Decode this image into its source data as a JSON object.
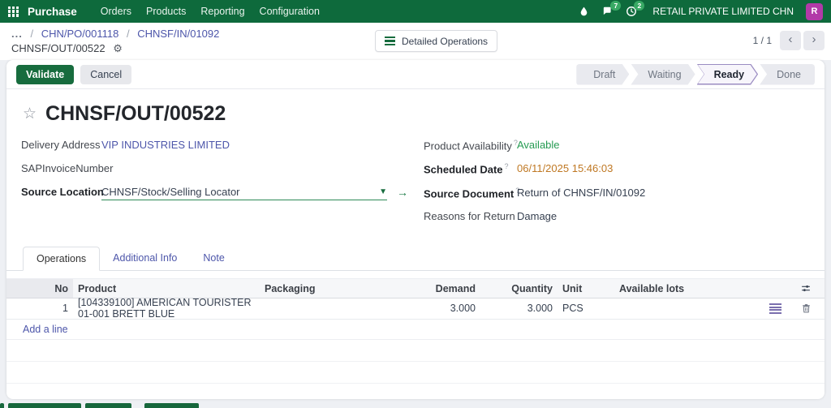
{
  "colors": {
    "nav_green": "#0e6a3c",
    "accent_green": "#176c3e",
    "link_purple": "#4d56aa",
    "available_green": "#259b52",
    "date_orange": "#bf7823",
    "ready_step_purple": "#9b8cc2",
    "avatar_magenta": "#b23aa8"
  },
  "icons": {
    "gear": "⚙",
    "star": "☆",
    "caret_down": "▼",
    "internal_link_arrow": "→",
    "prev": "‹",
    "next": "›"
  },
  "nav": {
    "app_name": "Purchase",
    "menus": [
      "Orders",
      "Products",
      "Reporting",
      "Configuration"
    ],
    "messages_count": "7",
    "activities_count": "2",
    "company": "RETAIL PRIVATE LIMITED CHN",
    "avatar_initial": "R"
  },
  "breadcrumb": {
    "ellipsis": "...",
    "separator": "/",
    "link1": "CHN/PO/001118",
    "link2": "CHNSF/IN/01092",
    "current": "CHNSF/OUT/00522"
  },
  "controlbar": {
    "detailed_operations": "Detailed Operations",
    "pager": "1 / 1",
    "validate": "Validate",
    "cancel": "Cancel",
    "status_steps": [
      "Draft",
      "Waiting",
      "Ready",
      "Done"
    ],
    "active_step": "Ready"
  },
  "form": {
    "title": "CHNSF/OUT/00522",
    "help_marker": "?",
    "delivery_address_label": "Delivery Address",
    "delivery_address_value": "VIP INDUSTRIES LIMITED",
    "sap_invoice_label": "SAPInvoiceNumber",
    "sap_invoice_value": "",
    "source_location_label": "Source Location",
    "source_location_value": "CHNSF/Stock/Selling Locator",
    "product_availability_label": "Product Availability",
    "product_availability_value": "Available",
    "scheduled_date_label": "Scheduled Date",
    "scheduled_date_value": "06/11/2025 15:46:03",
    "source_document_label": "Source Document",
    "source_document_value": "Return of CHNSF/IN/01092",
    "reasons_label": "Reasons for Return",
    "reasons_value": "Damage"
  },
  "tabs": [
    "Operations",
    "Additional Info",
    "Note"
  ],
  "table": {
    "headers": {
      "no": "No",
      "product": "Product",
      "packaging": "Packaging",
      "demand": "Demand",
      "quantity": "Quantity",
      "unit": "Unit",
      "lots": "Available lots"
    },
    "row": {
      "no": "1",
      "product": "[104339100] AMERICAN TOURISTER 01-001 BRETT BLUE",
      "packaging": "",
      "demand": "3.000",
      "quantity": "3.000",
      "unit": "PCS",
      "lots": ""
    },
    "add_line": "Add a line"
  }
}
